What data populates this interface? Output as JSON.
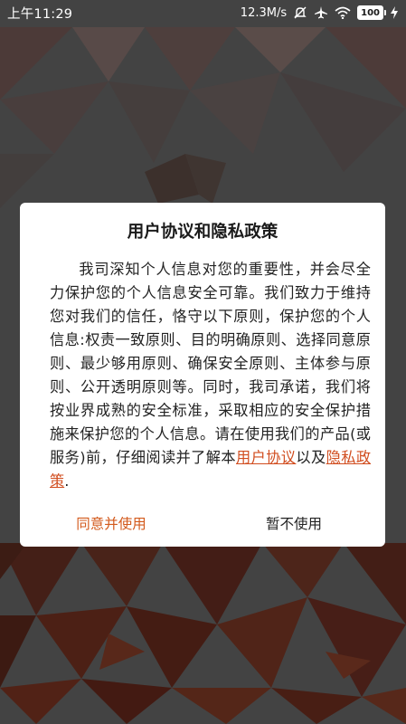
{
  "status_bar": {
    "time": "上午11:29",
    "network_speed": "12.3M/s",
    "battery_level": "100",
    "icons": [
      "mute-icon",
      "airplane-icon",
      "wifi-icon",
      "battery-icon",
      "charging-icon"
    ]
  },
  "dialog": {
    "title": "用户协议和隐私政策",
    "body_text": "我司深知个人信息对您的重要性，并会尽全力保护您的个人信息安全可靠。我们致力于维持您对我们的信任，恪守以下原则，保护您的个人信息:权责一致原则、目的明确原则、选择同意原则、最少够用原则、确保安全原则、主体参与原则、公开透明原则等。同时，我司承诺，我们将按业界成熟的安全标准，采取相应的安全保护措施来保护您的个人信息。请在使用我们的产品(或服务)前，仔细阅读并了解本",
    "user_agreement_link": "用户协议",
    "connector": "以及",
    "privacy_policy_link": "隐私政策",
    "ending": ".",
    "agree_button": "同意并使用",
    "disagree_button": "暂不使用"
  },
  "colors": {
    "accent": "#d35a1c",
    "link": "#d14d1f",
    "background_mosaic": "#b23a1c"
  }
}
